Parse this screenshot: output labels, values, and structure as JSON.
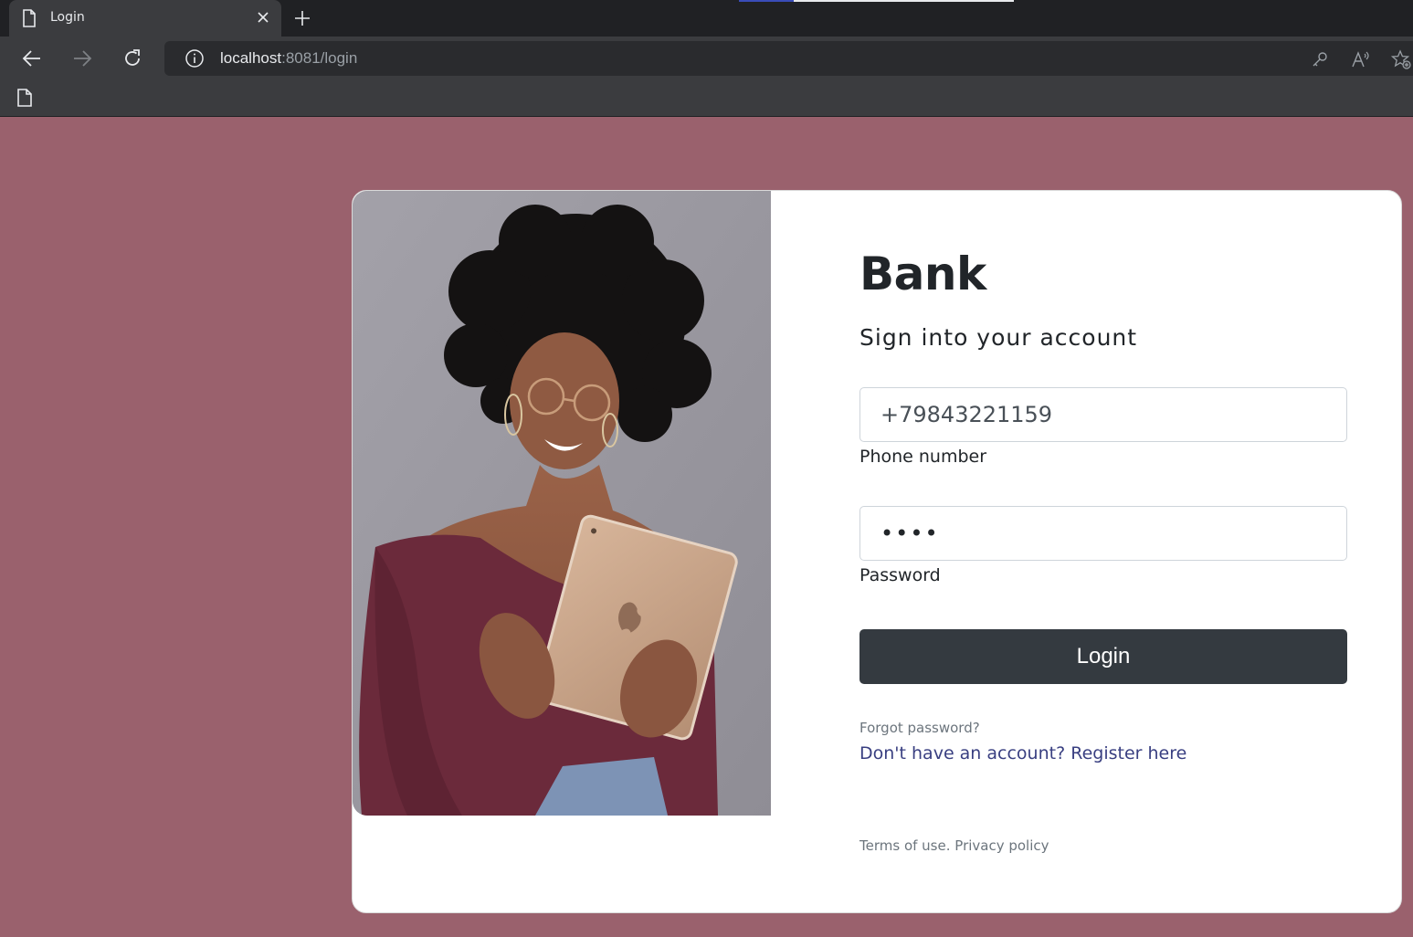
{
  "browser": {
    "tab_title": "Login",
    "url_host": "localhost",
    "url_rest": ":8081/login",
    "icons": {
      "favicon": "page-icon",
      "close": "close-icon",
      "new_tab": "plus-icon",
      "back": "arrow-left-icon",
      "forward": "arrow-right-icon",
      "reload": "reload-icon",
      "site_info": "info-icon",
      "key": "key-icon",
      "read_aloud": "read-aloud-icon",
      "favorite": "star-add-icon",
      "bookmark": "page-icon"
    }
  },
  "page": {
    "background_color": "#9a616d",
    "brand": "Bank",
    "subtitle": "Sign into your account",
    "phone": {
      "value": "+79843221159",
      "label": "Phone number"
    },
    "password": {
      "value": "••••",
      "label": "Password"
    },
    "login_button": "Login",
    "forgot_password": "Forgot password?",
    "register_prefix": "Don't have an account?",
    "register_link": "Register here",
    "terms": "Terms of use.",
    "privacy": "Privacy policy"
  }
}
